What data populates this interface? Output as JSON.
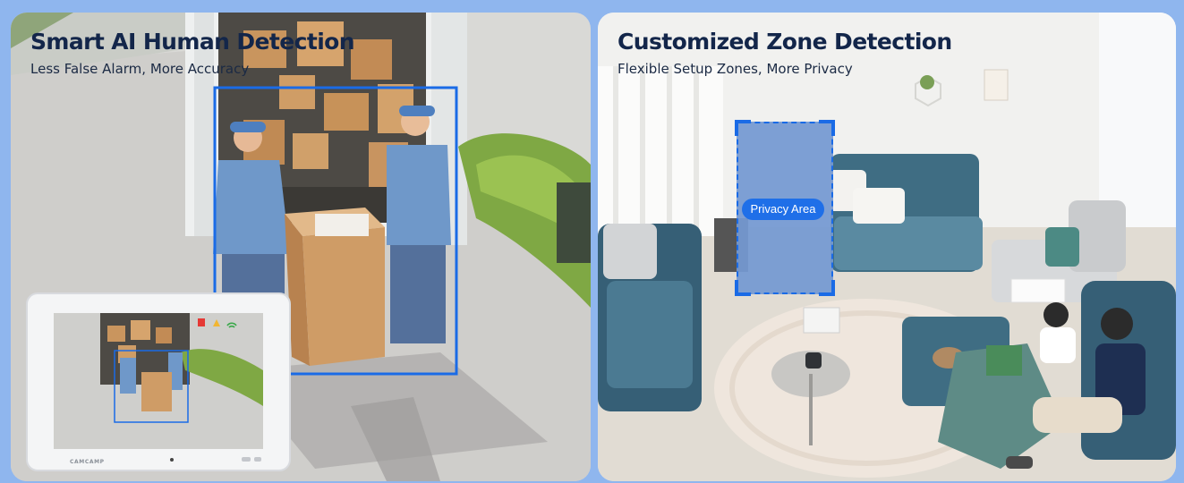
{
  "colors": {
    "frame": "#8fb6ee",
    "title": "#13264a",
    "accent_blue": "#1a6be6",
    "privacy_fill": "#7499d2",
    "pill": "#1f6fe8"
  },
  "left_panel": {
    "title": "Smart AI Human Detection",
    "subtitle": "Less False Alarm, More Accuracy",
    "monitor": {
      "brand": "CAMCAMP",
      "status_icons": [
        "record-icon",
        "person-alert-icon",
        "wifi-icon"
      ]
    }
  },
  "right_panel": {
    "title": "Customized Zone Detection",
    "subtitle": "Flexible Setup Zones, More Privacy",
    "privacy_label": "Privacy Area"
  }
}
